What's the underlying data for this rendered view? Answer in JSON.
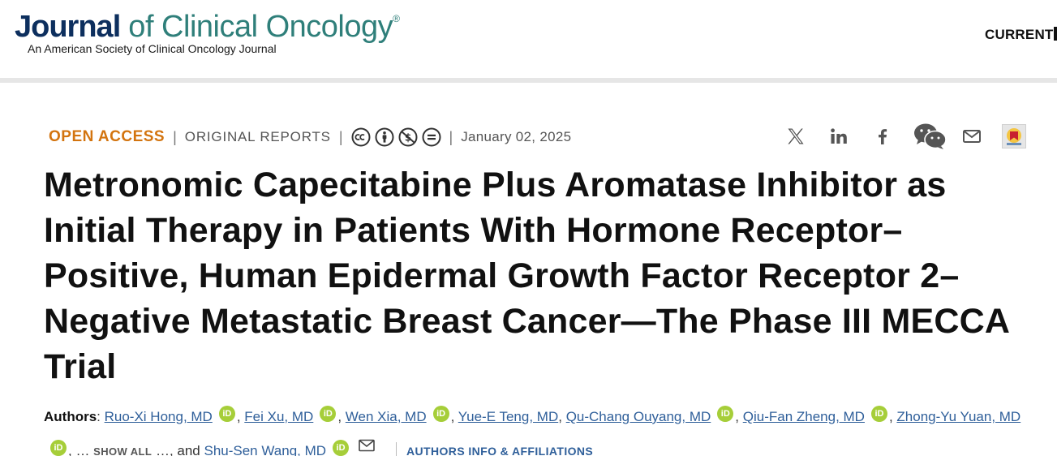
{
  "header": {
    "logo_journal": "Journal",
    "logo_rest": " of Clinical Oncology",
    "logo_reg": "®",
    "logo_subtitle": "An American Society of Clinical Oncology Journal",
    "nav_current": "CURRENT"
  },
  "meta": {
    "open_access": "OPEN ACCESS",
    "separator": "|",
    "article_type": "ORIGINAL REPORTS",
    "license_icons": [
      "cc-icon",
      "by-icon",
      "nc-icon",
      "nd-icon"
    ],
    "date": "January 02, 2025"
  },
  "share": {
    "icons": [
      "x-icon",
      "linkedin-icon",
      "facebook-icon",
      "wechat-icon",
      "email-icon",
      "mendeley-icon"
    ]
  },
  "article": {
    "title": "Metronomic Capecitabine Plus Aromatase Inhibitor as Initial Therapy in Patients With Hormone Receptor–Positive, Human Epidermal Growth Factor Receptor 2–Negative Metastatic Breast Cancer—The Phase III MECCA Trial"
  },
  "authors": {
    "label": "Authors",
    "colon": ": ",
    "comma": ", ",
    "names": [
      "Ruo-Xi Hong, MD",
      "Fei Xu, MD",
      "Wen Xia, MD",
      "Yue-E Teng, MD",
      "Qu-Chang Ouyang, MD",
      "Qiu-Fan Zheng, MD",
      "Zhong-Yu Yuan, MD",
      "Shu-Sen Wang, MD"
    ],
    "ellipsis_before": ", … ",
    "show_all": "SHOW ALL",
    "ellipsis_after": " …, and ",
    "orcid_label": "iD",
    "affiliations_link": "AUTHORS INFO & AFFILIATIONS"
  },
  "colors": {
    "open_access": "#d3740f",
    "link": "#2f5f9a",
    "logo_navy": "#0d2f5e",
    "logo_teal": "#2f7f7a",
    "orcid_green": "#a6ce39"
  }
}
